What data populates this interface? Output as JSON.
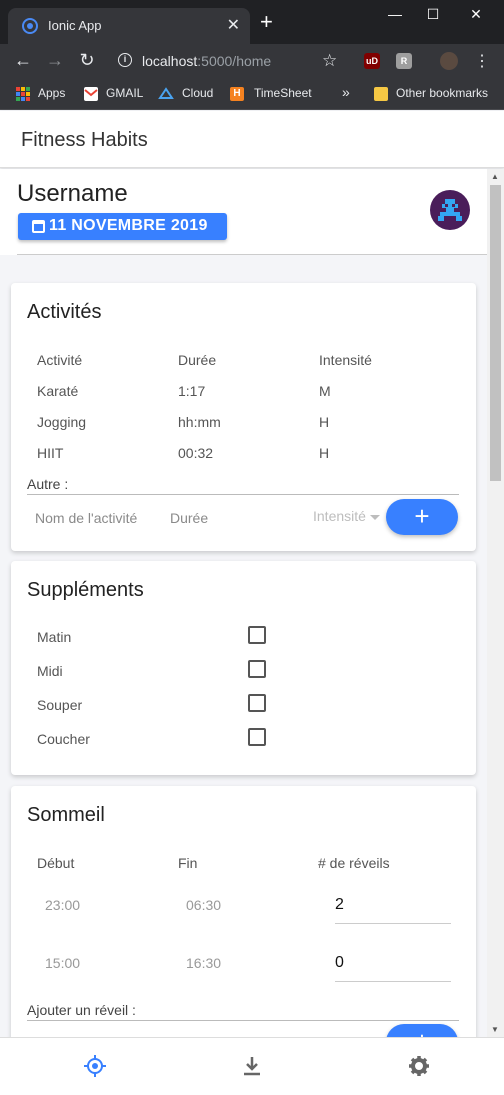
{
  "browser": {
    "tab_title": "Ionic App",
    "url_host": "localhost",
    "url_rest": ":5000/home",
    "bookmarks": {
      "apps": "Apps",
      "gmail": "GMAIL",
      "cloud": "Cloud",
      "timesheet": "TimeSheet",
      "more": "»",
      "other": "Other bookmarks"
    }
  },
  "app": {
    "title": "Fitness Habits",
    "username": "Username",
    "date": "11 NOVEMBRE 2019"
  },
  "activities": {
    "title": "Activités",
    "headers": [
      "Activité",
      "Durée",
      "Intensité"
    ],
    "rows": [
      [
        "Karaté",
        "1:17",
        "M"
      ],
      [
        "Jogging",
        "hh:mm",
        "H"
      ],
      [
        "HIIT",
        "00:32",
        "H"
      ]
    ],
    "other_label": "Autre :",
    "name_placeholder": "Nom de l'activité",
    "duration_placeholder": "Durée",
    "intensity_placeholder": "Intensité",
    "add_label": "+"
  },
  "supplements": {
    "title": "Suppléments",
    "items": [
      "Matin",
      "Midi",
      "Souper",
      "Coucher"
    ]
  },
  "sleep": {
    "title": "Sommeil",
    "headers": [
      "Début",
      "Fin",
      "# de réveils"
    ],
    "rows": [
      [
        "23:00",
        "06:30",
        "2"
      ],
      [
        "15:00",
        "16:30",
        "0"
      ]
    ],
    "add_wake_label": "Ajouter un réveil :"
  },
  "colors": {
    "accent": "#3880ff",
    "profile_bg": "#4a1d5a"
  },
  "tabbar_icons": [
    "locate-icon",
    "download-icon",
    "settings-icon"
  ]
}
